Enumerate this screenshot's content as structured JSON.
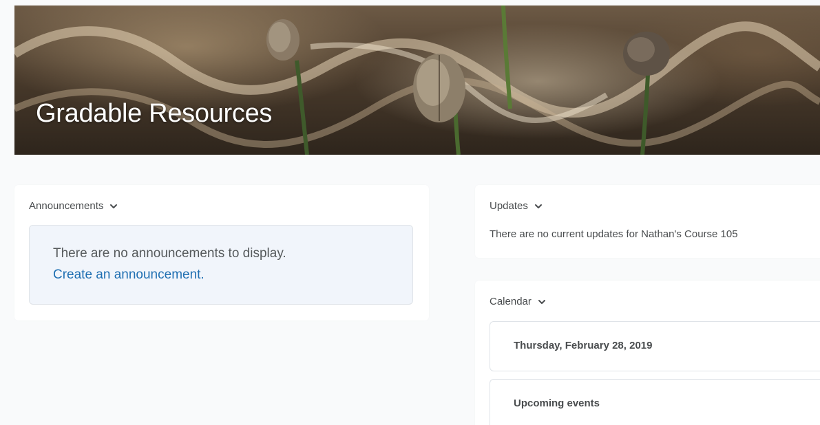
{
  "banner": {
    "title": "Gradable Resources"
  },
  "announcements": {
    "header": "Announcements",
    "empty_text": "There are no announcements to display.",
    "create_link": "Create an announcement."
  },
  "updates": {
    "header": "Updates",
    "text": "There are no current updates for Nathan's Course 105"
  },
  "calendar": {
    "header": "Calendar",
    "date": "Thursday, February 28, 2019",
    "upcoming": "Upcoming events"
  },
  "colors": {
    "link": "#1f6fb2",
    "page_bg": "#f9fafb",
    "card_bg": "#ffffff",
    "inner_bg": "#f1f5fb"
  },
  "icons": {
    "collapse": "chevron-down-icon"
  }
}
